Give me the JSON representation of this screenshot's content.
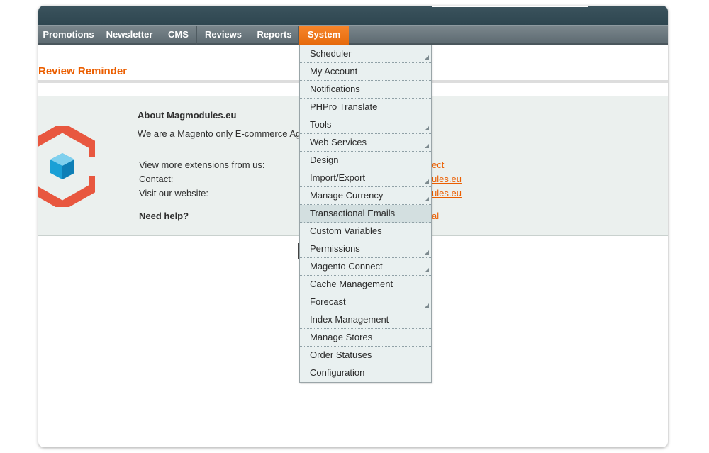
{
  "nav": {
    "items": [
      "Promotions",
      "Newsletter",
      "CMS",
      "Reviews",
      "Reports",
      "System"
    ],
    "active": "System"
  },
  "page": {
    "title": "Review Reminder"
  },
  "about": {
    "heading": "About Magmodules.eu",
    "intro": "We are a Magento only E-commerce Agenc",
    "view_label": "View more extensions from us:",
    "contact_label": "Contact:",
    "website_label": "Visit our website:",
    "help_label": "Need help?",
    "view_link": "ect",
    "contact_link": "ules.eu",
    "website_link": "ules.eu",
    "help_link": "al"
  },
  "system_menu": {
    "items": [
      {
        "label": "Scheduler",
        "submenu": true
      },
      {
        "label": "My Account",
        "submenu": false
      },
      {
        "label": "Notifications",
        "submenu": false
      },
      {
        "label": "PHPro Translate",
        "submenu": false
      },
      {
        "label": "Tools",
        "submenu": true
      },
      {
        "label": "Web Services",
        "submenu": true
      },
      {
        "label": "Design",
        "submenu": false
      },
      {
        "label": "Import/Export",
        "submenu": true
      },
      {
        "label": "Manage Currency",
        "submenu": true
      },
      {
        "label": "Transactional Emails",
        "submenu": false,
        "highlighted": true
      },
      {
        "label": "Custom Variables",
        "submenu": false
      },
      {
        "label": "Permissions",
        "submenu": true
      },
      {
        "label": "Magento Connect",
        "submenu": true
      },
      {
        "label": "Cache Management",
        "submenu": false
      },
      {
        "label": "Forecast",
        "submenu": true
      },
      {
        "label": "Index Management",
        "submenu": false
      },
      {
        "label": "Manage Stores",
        "submenu": false
      },
      {
        "label": "Order Statuses",
        "submenu": false
      },
      {
        "label": "Configuration",
        "submenu": false
      }
    ]
  },
  "colors": {
    "accent": "#eb5e00",
    "nav_bg": "#5d6a71",
    "header_bg": "#2e4650",
    "panel_bg": "#ebf0ee",
    "menu_bg": "#e9f0f0",
    "menu_highlight": "#d3dfe0"
  }
}
